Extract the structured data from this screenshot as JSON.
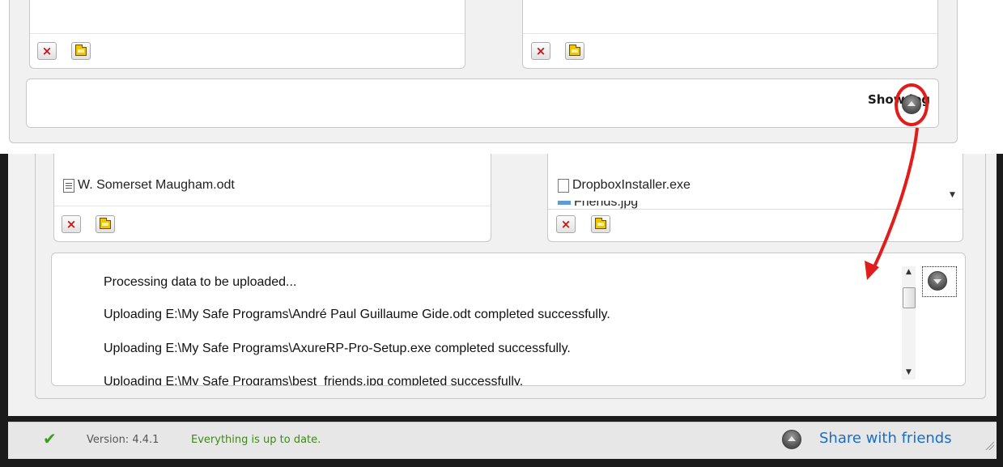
{
  "top_panel": {
    "show_log_label": "Show log"
  },
  "bottom_window": {
    "left_files": [
      "W. Somerset Maugham.odt"
    ],
    "right_files": [
      "DropboxInstaller.exe",
      "Friends.jpg"
    ],
    "log_lines": [
      "Processing data to be uploaded...",
      "Uploading E:\\My Safe Programs\\André Paul Guillaume Gide.odt completed successfully.",
      "Uploading E:\\My Safe Programs\\AxureRP-Pro-Setup.exe completed successfully.",
      "Uploading E:\\My Safe Programs\\best_friends.jpg completed successfully."
    ]
  },
  "status_bar": {
    "version_label": "Version: 4.4.1",
    "status_text": "Everything is up to date.",
    "share_label": "Share with friends"
  },
  "icons": {
    "remove": "close-x-icon",
    "open_folder": "folder-icon",
    "toggle_log": "round-arrow-icon",
    "ok": "checkmark-icon"
  },
  "colors": {
    "annotation": "#e21b1b",
    "link": "#1a6fc2",
    "ok_green": "#3aa01c"
  }
}
